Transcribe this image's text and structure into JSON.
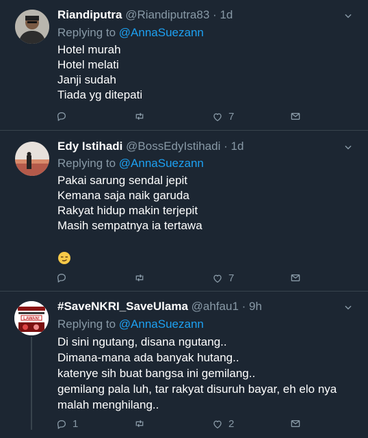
{
  "colors": {
    "background": "#1c2632",
    "divider": "#38444d",
    "secondary_text": "#8899a6",
    "mention": "#1da1f2"
  },
  "tweets": [
    {
      "name": "Riandiputra",
      "handle": "@Riandiputra83",
      "dot": "·",
      "time": "1d",
      "replying_prefix": "Replying to",
      "replying_to": "@AnnaSuezann",
      "lines": [
        "Hotel murah",
        "Hotel melati",
        "Janji sudah",
        "Tiada yg ditepati"
      ],
      "reply_count": "",
      "like_count": "7"
    },
    {
      "name": "Edy Istihadi",
      "handle": "@BossEdyIstihadi",
      "dot": "·",
      "time": "1d",
      "replying_prefix": "Replying to",
      "replying_to": "@AnnaSuezann",
      "lines": [
        "Pakai sarung sendal jepit",
        "Kemana saja naik garuda",
        "Rakyat hidup makin terjepit",
        "Masih sempatnya ia tertawa"
      ],
      "emoji": "smirking-face",
      "reply_count": "",
      "like_count": "7"
    },
    {
      "name": "#SaveNKRI_SaveUlama",
      "handle": "@ahfau1",
      "dot": "·",
      "time": "9h",
      "replying_prefix": "Replying to",
      "replying_to": "@AnnaSuezann",
      "lines": [
        "Di sini ngutang, disana ngutang..",
        "Dimana-mana ada banyak hutang..",
        "katenye sih buat bangsa ini gemilang..",
        "gemilang pala luh, tar rakyat disuruh bayar, eh elo nya",
        "malah menghilang.."
      ],
      "avatar_text": "LAWAN!",
      "reply_count": "1",
      "like_count": "2"
    }
  ]
}
